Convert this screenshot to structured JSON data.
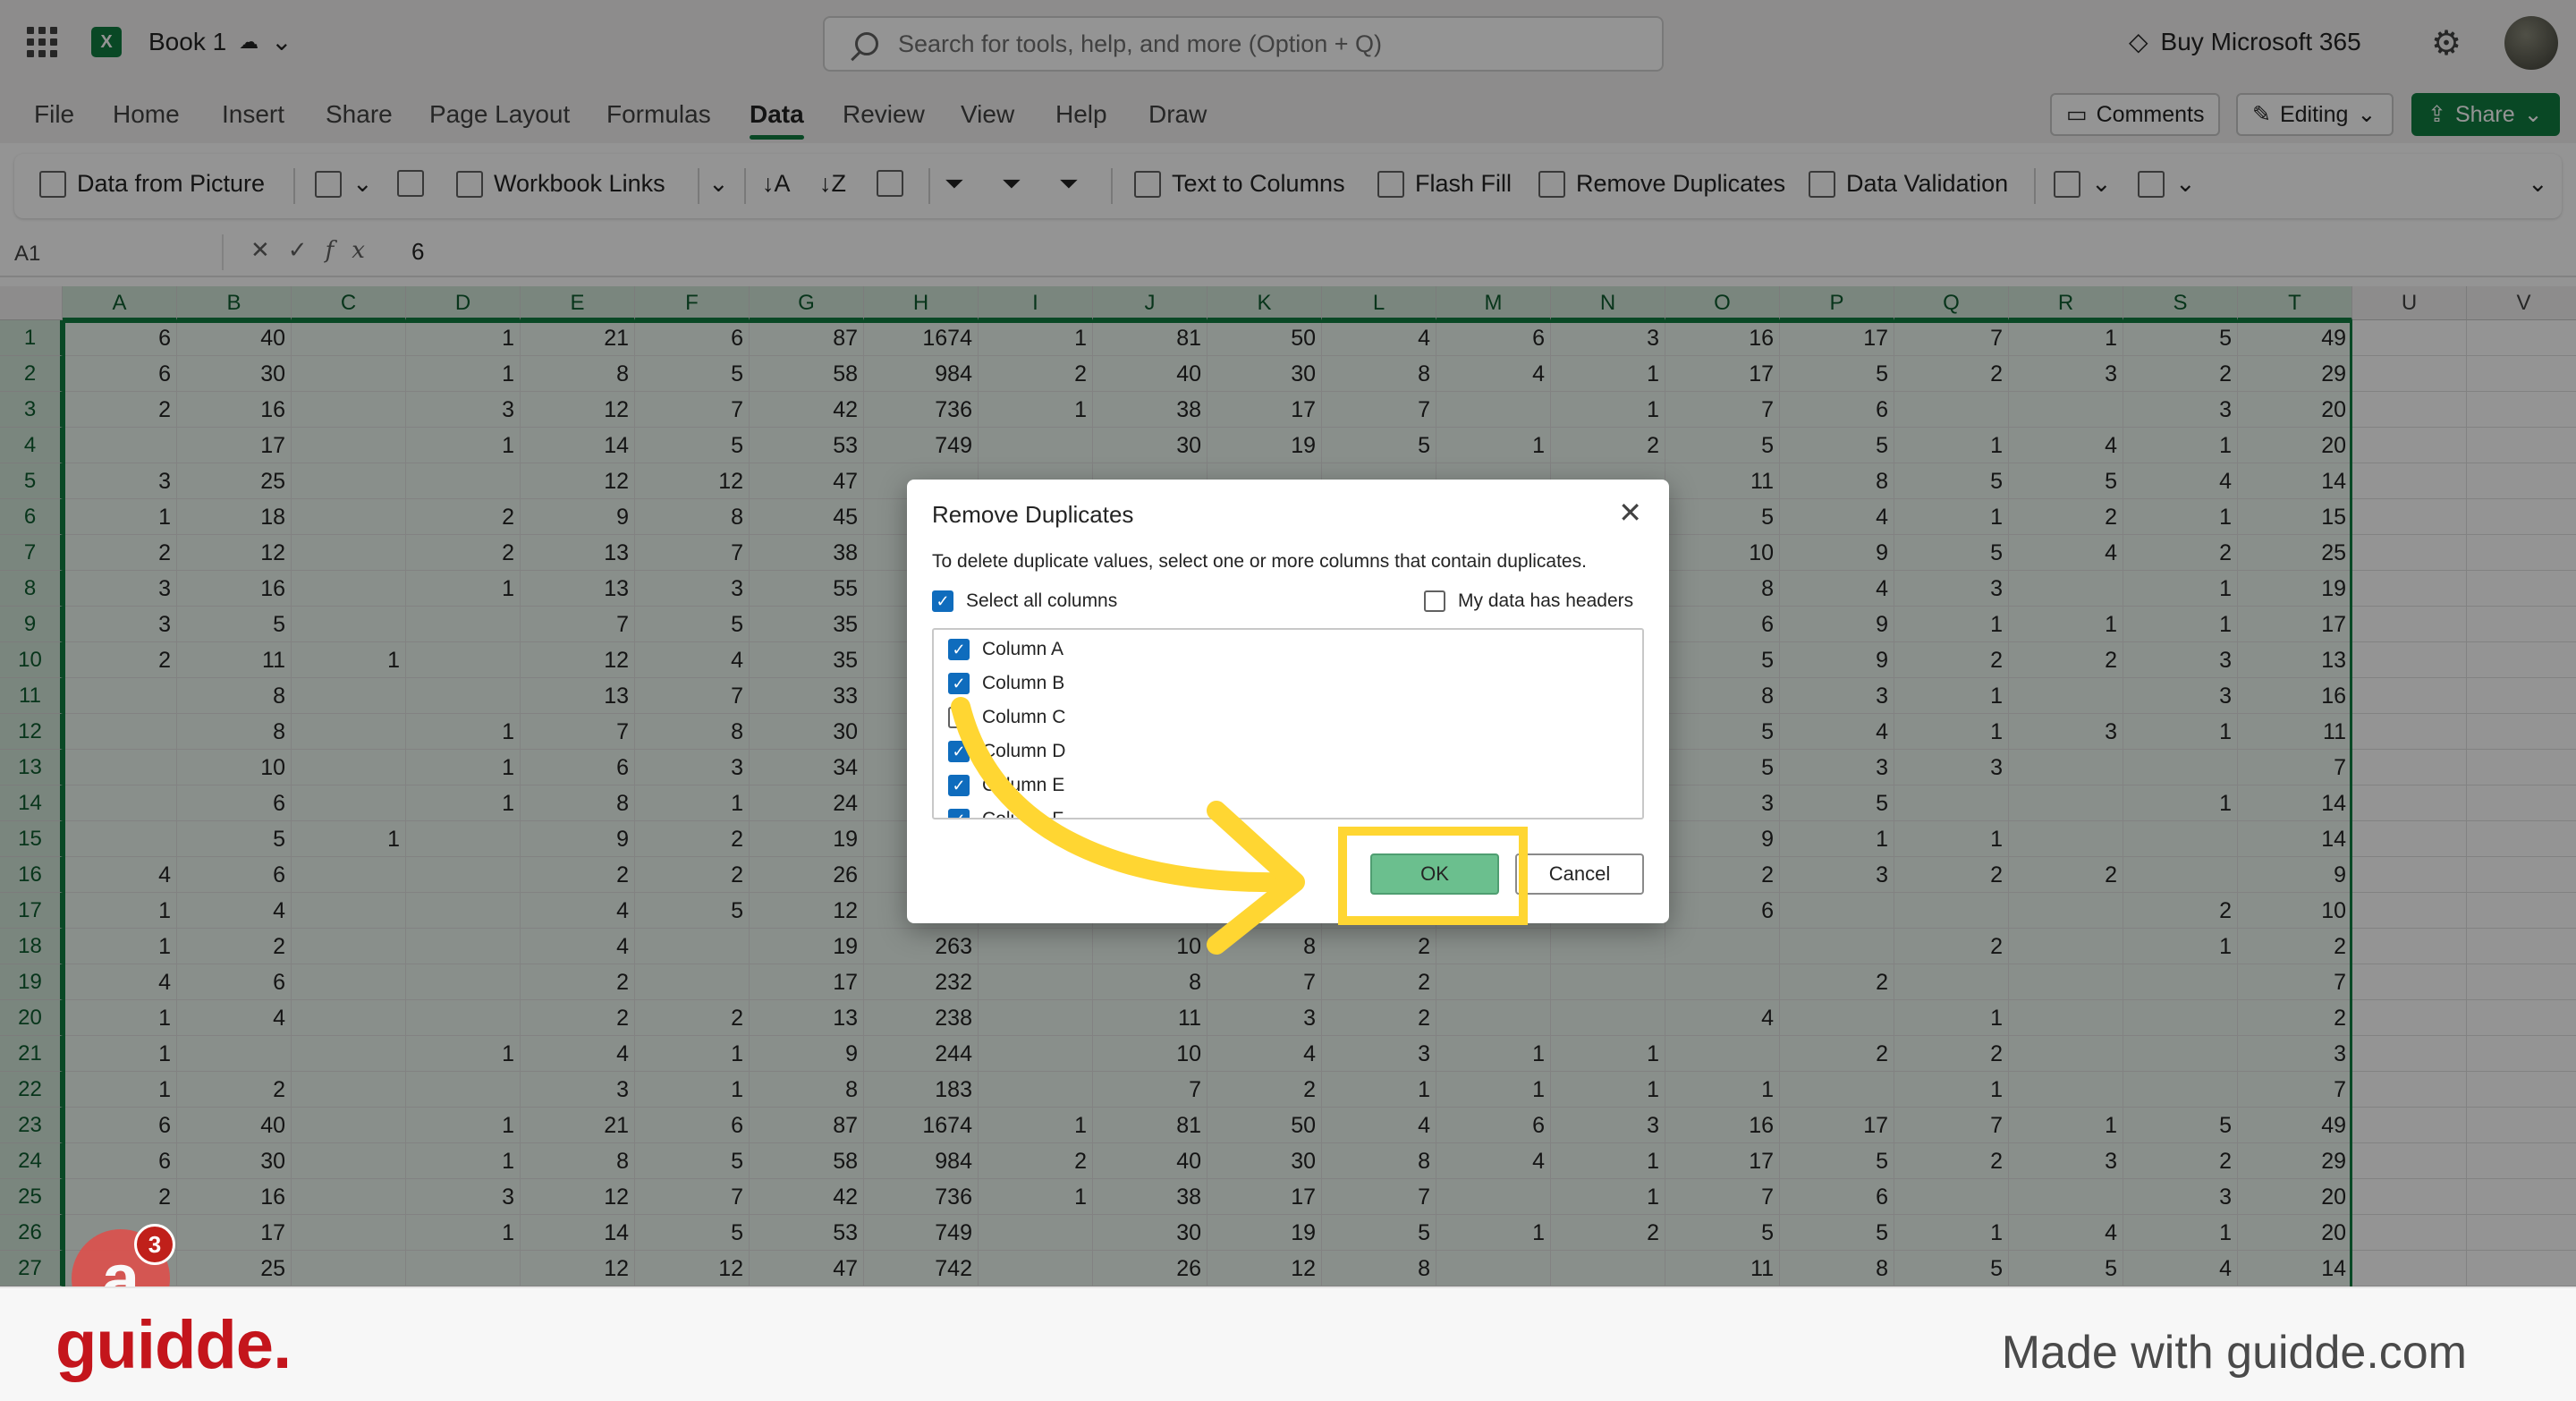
{
  "app": {
    "book_title": "Book 1",
    "search_placeholder": "Search for tools, help, and more (Option + Q)",
    "buy_label": "Buy Microsoft 365",
    "excel_logo": "X"
  },
  "menu": {
    "tabs": [
      "File",
      "Home",
      "Insert",
      "Share",
      "Page Layout",
      "Formulas",
      "Data",
      "Review",
      "View",
      "Help",
      "Draw"
    ],
    "active": "Data",
    "comments_label": "Comments",
    "editing_label": "Editing",
    "share_label": "Share"
  },
  "ribbon": {
    "data_from_picture": "Data from Picture",
    "workbook_links": "Workbook Links",
    "text_to_columns": "Text to Columns",
    "flash_fill": "Flash Fill",
    "remove_duplicates": "Remove Duplicates",
    "data_validation": "Data Validation"
  },
  "formula_bar": {
    "name_box": "A1",
    "fx": "fx",
    "value": "6"
  },
  "grid": {
    "columns": [
      "A",
      "B",
      "C",
      "D",
      "E",
      "F",
      "G",
      "H",
      "I",
      "J",
      "K",
      "L",
      "M",
      "N",
      "O",
      "P",
      "Q",
      "R",
      "S",
      "T",
      "U",
      "V"
    ],
    "rows": [
      [
        "6",
        "40",
        "",
        "1",
        "21",
        "6",
        "87",
        "1674",
        "1",
        "81",
        "50",
        "4",
        "6",
        "3",
        "16",
        "17",
        "7",
        "1",
        "5",
        "49"
      ],
      [
        "6",
        "30",
        "",
        "1",
        "8",
        "5",
        "58",
        "984",
        "2",
        "40",
        "30",
        "8",
        "4",
        "1",
        "17",
        "5",
        "2",
        "3",
        "2",
        "29"
      ],
      [
        "2",
        "16",
        "",
        "3",
        "12",
        "7",
        "42",
        "736",
        "1",
        "38",
        "17",
        "7",
        "",
        "1",
        "7",
        "6",
        "",
        "",
        "3",
        "20"
      ],
      [
        "",
        "17",
        "",
        "1",
        "14",
        "5",
        "53",
        "749",
        "",
        "30",
        "19",
        "5",
        "1",
        "2",
        "5",
        "5",
        "1",
        "4",
        "1",
        "20"
      ],
      [
        "3",
        "25",
        "",
        "",
        "12",
        "12",
        "47",
        "",
        "",
        "",
        "",
        "",
        "",
        "",
        "11",
        "8",
        "5",
        "5",
        "4",
        "14"
      ],
      [
        "1",
        "18",
        "",
        "2",
        "9",
        "8",
        "45",
        "",
        "",
        "",
        "",
        "",
        "",
        "",
        "5",
        "4",
        "1",
        "2",
        "1",
        "15"
      ],
      [
        "2",
        "12",
        "",
        "2",
        "13",
        "7",
        "38",
        "",
        "",
        "",
        "",
        "",
        "",
        "",
        "10",
        "9",
        "5",
        "4",
        "2",
        "25"
      ],
      [
        "3",
        "16",
        "",
        "1",
        "13",
        "3",
        "55",
        "",
        "",
        "",
        "",
        "",
        "",
        "",
        "8",
        "4",
        "3",
        "",
        "1",
        "19"
      ],
      [
        "3",
        "5",
        "",
        "",
        "7",
        "5",
        "35",
        "",
        "",
        "",
        "",
        "",
        "",
        "",
        "6",
        "9",
        "1",
        "1",
        "1",
        "17"
      ],
      [
        "2",
        "11",
        "1",
        "",
        "12",
        "4",
        "35",
        "",
        "",
        "",
        "",
        "",
        "",
        "",
        "5",
        "9",
        "2",
        "2",
        "3",
        "13"
      ],
      [
        "",
        "8",
        "",
        "",
        "13",
        "7",
        "33",
        "",
        "",
        "",
        "",
        "",
        "",
        "",
        "8",
        "3",
        "1",
        "",
        "3",
        "16"
      ],
      [
        "",
        "8",
        "",
        "1",
        "7",
        "8",
        "30",
        "",
        "",
        "",
        "",
        "",
        "",
        "",
        "5",
        "4",
        "1",
        "3",
        "1",
        "11"
      ],
      [
        "",
        "10",
        "",
        "1",
        "6",
        "3",
        "34",
        "",
        "",
        "",
        "",
        "",
        "",
        "",
        "5",
        "3",
        "3",
        "",
        "",
        "7"
      ],
      [
        "",
        "6",
        "",
        "1",
        "8",
        "1",
        "24",
        "",
        "",
        "",
        "",
        "",
        "",
        "",
        "3",
        "5",
        "",
        "",
        "1",
        "14"
      ],
      [
        "",
        "5",
        "1",
        "",
        "9",
        "2",
        "19",
        "",
        "",
        "",
        "",
        "",
        "",
        "",
        "9",
        "1",
        "1",
        "",
        "",
        "14"
      ],
      [
        "4",
        "6",
        "",
        "",
        "2",
        "2",
        "26",
        "",
        "",
        "",
        "",
        "",
        "",
        "",
        "2",
        "3",
        "2",
        "2",
        "",
        "9"
      ],
      [
        "1",
        "4",
        "",
        "",
        "4",
        "5",
        "12",
        "",
        "",
        "",
        "",
        "",
        "",
        "",
        "6",
        "",
        "",
        "",
        "2",
        "10"
      ],
      [
        "1",
        "2",
        "",
        "",
        "4",
        "",
        "19",
        "263",
        "",
        "10",
        "8",
        "2",
        "",
        "",
        "",
        "",
        "2",
        "",
        "1",
        "2"
      ],
      [
        "4",
        "6",
        "",
        "",
        "2",
        "",
        "17",
        "232",
        "",
        "8",
        "7",
        "2",
        "",
        "",
        "",
        "2",
        "",
        "",
        "",
        "7"
      ],
      [
        "1",
        "4",
        "",
        "",
        "2",
        "2",
        "13",
        "238",
        "",
        "11",
        "3",
        "2",
        "",
        "",
        "4",
        "",
        "1",
        "",
        "",
        "2"
      ],
      [
        "1",
        "",
        "",
        "1",
        "4",
        "1",
        "9",
        "244",
        "",
        "10",
        "4",
        "3",
        "1",
        "1",
        "",
        "2",
        "2",
        "",
        "",
        "3"
      ],
      [
        "1",
        "2",
        "",
        "",
        "3",
        "1",
        "8",
        "183",
        "",
        "7",
        "2",
        "1",
        "1",
        "1",
        "1",
        "",
        "1",
        "",
        "",
        "7"
      ],
      [
        "6",
        "40",
        "",
        "1",
        "21",
        "6",
        "87",
        "1674",
        "1",
        "81",
        "50",
        "4",
        "6",
        "3",
        "16",
        "17",
        "7",
        "1",
        "5",
        "49"
      ],
      [
        "6",
        "30",
        "",
        "1",
        "8",
        "5",
        "58",
        "984",
        "2",
        "40",
        "30",
        "8",
        "4",
        "1",
        "17",
        "5",
        "2",
        "3",
        "2",
        "29"
      ],
      [
        "2",
        "16",
        "",
        "3",
        "12",
        "7",
        "42",
        "736",
        "1",
        "38",
        "17",
        "7",
        "",
        "1",
        "7",
        "6",
        "",
        "",
        "3",
        "20"
      ],
      [
        "",
        "17",
        "",
        "1",
        "14",
        "5",
        "53",
        "749",
        "",
        "30",
        "19",
        "5",
        "1",
        "2",
        "5",
        "5",
        "1",
        "4",
        "1",
        "20"
      ],
      [
        "",
        "25",
        "",
        "",
        "12",
        "12",
        "47",
        "742",
        "",
        "26",
        "12",
        "8",
        "",
        "",
        "11",
        "8",
        "5",
        "5",
        "4",
        "14"
      ]
    ]
  },
  "dialog": {
    "title": "Remove Duplicates",
    "description": "To delete duplicate values, select one or more columns that contain duplicates.",
    "select_all_label": "Select all columns",
    "headers_label": "My data has headers",
    "columns": [
      {
        "label": "Column A",
        "checked": true
      },
      {
        "label": "Column B",
        "checked": true
      },
      {
        "label": "Column C",
        "checked": false
      },
      {
        "label": "Column D",
        "checked": true
      },
      {
        "label": "Column E",
        "checked": true
      },
      {
        "label": "Column F",
        "checked": true
      }
    ],
    "ok_label": "OK",
    "cancel_label": "Cancel"
  },
  "badge": {
    "letter": "a",
    "count": "3"
  },
  "footer": {
    "logo": "guidde.",
    "made_with": "Made with guidde.com"
  },
  "colors": {
    "accent": "#107c41",
    "highlight": "#ffd632",
    "brand": "#c4151c"
  }
}
